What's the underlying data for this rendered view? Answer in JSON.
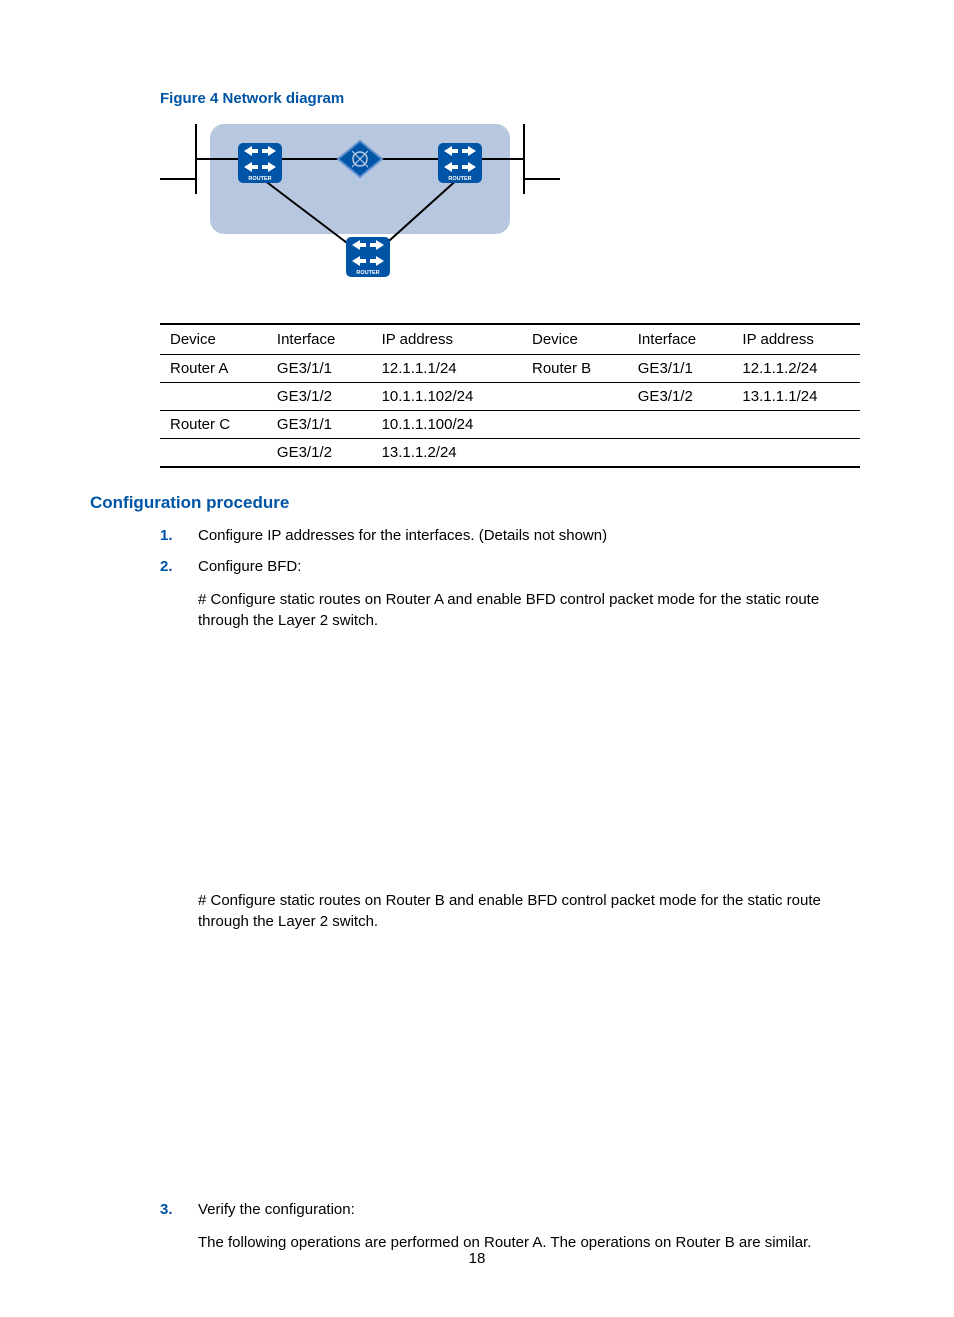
{
  "figure_caption": "Figure 4 Network diagram",
  "table": {
    "headers": [
      "Device",
      "Interface",
      "IP address",
      "Device",
      "Interface",
      "IP address"
    ],
    "rows": [
      {
        "cells": [
          "Router A",
          "GE3/1/1",
          "12.1.1.1/24",
          "Router B",
          "GE3/1/1",
          "12.1.1.2/24"
        ],
        "top": true
      },
      {
        "cells": [
          "",
          "GE3/1/2",
          "10.1.1.102/24",
          "",
          "GE3/1/2",
          "13.1.1.1/24"
        ],
        "top": true
      },
      {
        "cells": [
          "Router C",
          "GE3/1/1",
          "10.1.1.100/24",
          "",
          "",
          ""
        ],
        "top": true
      },
      {
        "cells": [
          "",
          "GE3/1/2",
          "13.1.1.2/24",
          "",
          "",
          ""
        ],
        "top": true,
        "bottom": true
      }
    ]
  },
  "section_heading": "Configuration procedure",
  "steps": [
    {
      "text": "Configure IP addresses for the interfaces. (Details not shown)",
      "subs": []
    },
    {
      "text": "Configure BFD:",
      "subs": [
        {
          "text": "# Configure static routes on Router A and enable BFD control packet mode for the static route through the Layer 2 switch.",
          "spacer": "a"
        },
        {
          "text": "# Configure static routes on Router B and enable BFD control packet mode for the static route through the Layer 2 switch.",
          "spacer": "b"
        }
      ]
    },
    {
      "text": "Verify the configuration:",
      "subs": [
        {
          "text": "The following operations are performed on Router A. The operations on Router B are similar."
        }
      ]
    }
  ],
  "diagram": {
    "router_label": "ROUTER"
  },
  "page_number": "18"
}
